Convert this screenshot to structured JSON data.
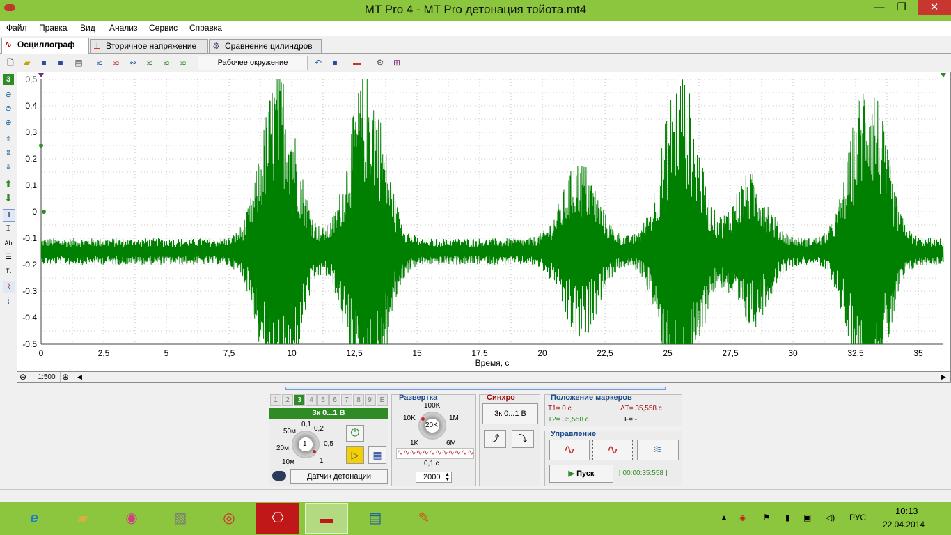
{
  "window": {
    "title": "MT Pro 4 - MT Pro детонация тойота.mt4",
    "minimize": "—",
    "maximize": "❐",
    "close": "✕"
  },
  "menu": [
    "Файл",
    "Правка",
    "Вид",
    "Анализ",
    "Сервис",
    "Справка"
  ],
  "tabs": [
    {
      "label": "Осциллограф",
      "icon": "∿"
    },
    {
      "label": "Вторичное напряжение",
      "icon": "⊥"
    },
    {
      "label": "Сравнение цилиндров",
      "icon": "⚙"
    }
  ],
  "toolbar": {
    "workspace": "Рабочее окружение"
  },
  "left_tools": {
    "channel_badge": "3"
  },
  "chart_data": {
    "type": "line",
    "xlabel": "Время, с",
    "ylabel": "",
    "xlim": [
      0,
      36
    ],
    "ylim": [
      -0.5,
      0.5
    ],
    "x_ticks": [
      "0",
      "2,5",
      "5",
      "7,5",
      "10",
      "12,5",
      "15",
      "17,5",
      "20",
      "22,5",
      "25",
      "27,5",
      "30",
      "32,5",
      "35"
    ],
    "y_ticks": [
      "0,5",
      "0,4",
      "0,3",
      "0,2",
      "0,1",
      "0",
      "-0.1",
      "-0.2",
      "-0.3",
      "-0.4",
      "-0.5"
    ],
    "series": [
      {
        "color": "#008000",
        "baseline": -0.15,
        "base_amplitude": 0.05,
        "bursts": [
          {
            "center": 9.5,
            "amplitude": 0.65
          },
          {
            "center": 13.0,
            "amplitude": 0.65
          },
          {
            "center": 21.5,
            "amplitude": 0.3
          },
          {
            "center": 25.5,
            "amplitude": 0.65
          },
          {
            "center": 28.3,
            "amplitude": 0.25
          },
          {
            "center": 33.0,
            "amplitude": 0.65
          }
        ]
      }
    ],
    "grid": true
  },
  "scroll": {
    "zoom": "1:500"
  },
  "channel_panel": {
    "tabs": [
      "1",
      "2",
      "3",
      "4",
      "5",
      "6",
      "7",
      "8",
      "9'",
      "E"
    ],
    "active_tab": "3",
    "range_label": "3к 0...1 В",
    "knob_labels": [
      "50м",
      "0,1",
      "0,2",
      "20м",
      "0,5",
      "10м",
      "1"
    ],
    "knob_value": "1",
    "sensor": "Датчик детонации"
  },
  "sweep_panel": {
    "title": "Развертка",
    "knob_labels": [
      "100K",
      "10K",
      "1M",
      "1K",
      "6M"
    ],
    "knob_value": "20K",
    "time": "0,1 с",
    "samples": "2000"
  },
  "sync_panel": {
    "title": "Синхро",
    "button": "3к 0...1 В"
  },
  "markers_panel": {
    "title": "Положение маркеров",
    "t1": "T1= 0 с",
    "t2": "T2= 35,558 с",
    "dt": "ΔT= 35,558 с",
    "f": "F= -"
  },
  "control_panel": {
    "title": "Управление",
    "start": "Пуск",
    "timer": "[ 00:00:35:558 ]"
  },
  "taskbar": {
    "apps": [
      "ie-icon",
      "explorer-icon",
      "media-icon",
      "tool-icon",
      "chrome-icon",
      "pdf-icon",
      "mtpro-icon",
      "control-panel-icon",
      "paint-icon"
    ],
    "language": "РУС",
    "time": "10:13",
    "date": "22.04.2014"
  }
}
